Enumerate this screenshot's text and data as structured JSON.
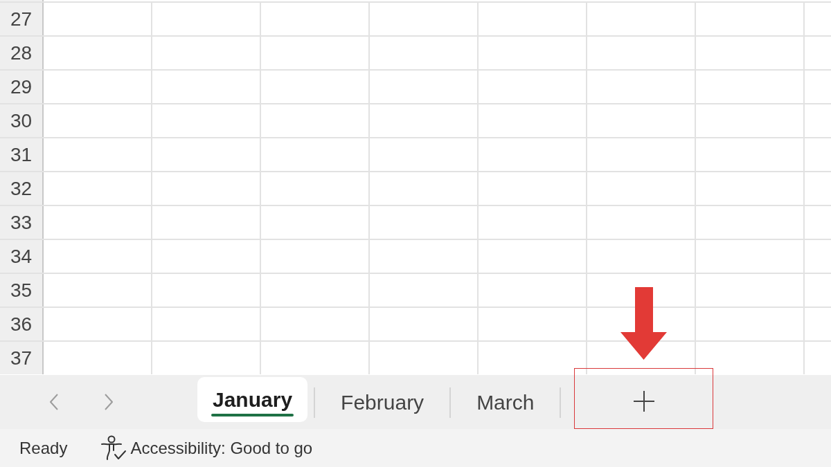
{
  "row_headers": [
    "27",
    "28",
    "29",
    "30",
    "31",
    "32",
    "33",
    "34",
    "35",
    "36",
    "37"
  ],
  "sheet_tabs": [
    {
      "label": "January",
      "selected": true
    },
    {
      "label": "February",
      "selected": false
    },
    {
      "label": "March",
      "selected": false
    }
  ],
  "new_sheet_button": {
    "highlighted": true
  },
  "status_bar": {
    "mode": "Ready",
    "accessibility": "Accessibility: Good to go"
  }
}
